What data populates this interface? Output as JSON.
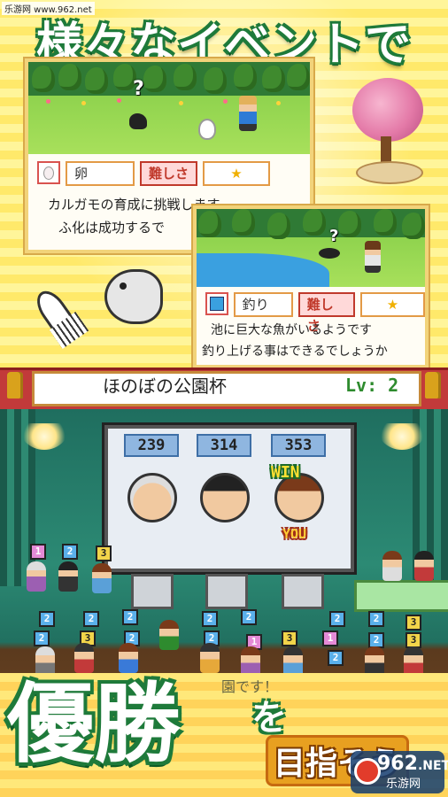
{
  "watermark": "乐游网 www.962.net",
  "headline": "様々なイベントで",
  "event1": {
    "item_name": "卵",
    "difficulty_label": "難しさ",
    "stars": "★",
    "message_line1": "カルガモの育成に挑戦します",
    "message_line2": "ふ化は成功するで"
  },
  "event2": {
    "item_name": "釣り",
    "difficulty_label": "難しさ",
    "stars": "★",
    "message_line1": "池に巨大な魚がいるようです",
    "message_line2": "釣り上げる事はできるでしょうか"
  },
  "tournament": {
    "title": "ほのぼの公園杯",
    "level": "Lv: 2"
  },
  "scoreboard": {
    "scores": [
      "239",
      "314",
      "353"
    ],
    "win_label": "WIN",
    "you_label": "YOU"
  },
  "badges": {
    "stage": [
      "1",
      "2",
      "3"
    ],
    "crowd": [
      "2",
      "2",
      "2",
      "2",
      "2",
      "2",
      "2",
      "3",
      "3",
      "3",
      "2",
      "1",
      "2",
      "2",
      "2",
      "3",
      "1",
      "2",
      "3",
      "3",
      "3",
      "2"
    ]
  },
  "ticker_text": "園です！",
  "bottom": {
    "big_text": "優勝",
    "particle": "を",
    "goal": "目指そう"
  },
  "site_logo": {
    "number": "962",
    "suffix": ".NET",
    "caption": "乐游网"
  },
  "colors": {
    "headline_outline": "#1e7a3a",
    "tournament_bar": "#c23a3a",
    "level_text": "#2e8b2e"
  }
}
